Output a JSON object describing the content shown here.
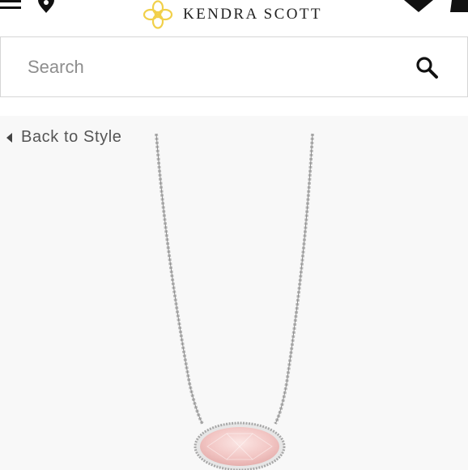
{
  "header": {
    "brand_name": "KENDRA SCOTT",
    "icons": [
      "menu-icon",
      "location-pin-icon",
      "logo-icon",
      "heart-icon",
      "bag-icon"
    ]
  },
  "search": {
    "placeholder": "Search",
    "value": "",
    "icon": "search-icon"
  },
  "navigation": {
    "back_label": "Back to Style",
    "back_icon": "caret-left-icon"
  },
  "product": {
    "image": "silver-chain-necklace-with-rose-quartz-oval-stone"
  },
  "colors": {
    "logo_gold": "#f1d04a",
    "stone_pink": "#f2c6c4",
    "text_dark": "#222222",
    "background_gray": "#f8f8f8"
  }
}
